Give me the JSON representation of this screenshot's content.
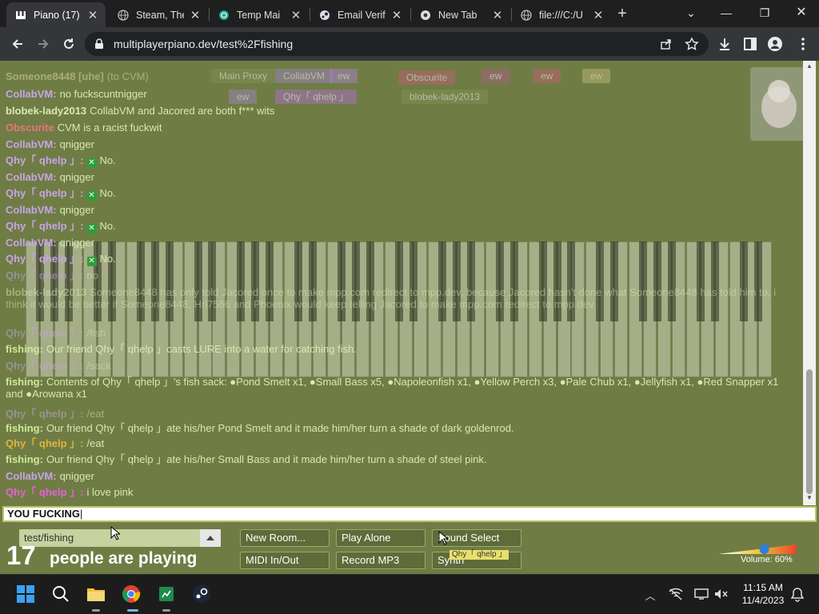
{
  "browser": {
    "tabs": [
      {
        "label": "Piano (17)",
        "icon": "piano-icon",
        "active": true
      },
      {
        "label": "Steam, The",
        "icon": "globe-icon",
        "active": false
      },
      {
        "label": "Temp Mai",
        "icon": "temp-mail-icon",
        "active": false
      },
      {
        "label": "Email Verif",
        "icon": "steam-icon",
        "active": false
      },
      {
        "label": "New Tab",
        "icon": "chrome-icon",
        "active": false
      },
      {
        "label": "file:///C:/U",
        "icon": "globe-icon",
        "active": false
      }
    ],
    "url": "multiplayerpiano.dev/test%2Ffishing"
  },
  "piano_bar": {
    "names": [
      "Main Proxy",
      "CollabVM",
      "ew",
      "ew",
      "ew",
      "ew",
      "Qhy「 qhelp 」",
      "blobek-lady2013",
      "Obscurite"
    ]
  },
  "chat": {
    "lines": [
      {
        "who": "Someone8448 [uhe]",
        "text": "(to CVM)",
        "color": "#e3d9a9",
        "fade": true
      },
      {
        "who": "CollabVM:",
        "text": "no fuckscuntnigger",
        "color": "#c7a4e8",
        "fade": false
      },
      {
        "who": "blobek-lady2013",
        "text": "CollabVM and Jacored are both f*** wits",
        "color": "#d9e8b2",
        "fade": false
      },
      {
        "who": "Obscurite",
        "text": "CVM is a racist fuckwit",
        "color": "#e6757a",
        "fade": false
      },
      {
        "who": "CollabVM:",
        "text": "qnigger",
        "color": "#c7a4e8",
        "fade": false
      },
      {
        "who": "Qhy「 qhelp 」:",
        "text": "No.",
        "color": "#c7a4e8",
        "fade": false
      },
      {
        "who": "CollabVM:",
        "text": "qnigger",
        "color": "#c7a4e8",
        "fade": false
      },
      {
        "who": "Qhy「 qhelp 」:",
        "text": "No.",
        "color": "#c7a4e8",
        "fade": false
      },
      {
        "who": "CollabVM:",
        "text": "qnigger",
        "color": "#c7a4e8",
        "fade": false
      },
      {
        "who": "Qhy「 qhelp 」:",
        "text": "No.",
        "color": "#c7a4e8",
        "fade": false
      },
      {
        "who": "CollabVM:",
        "text": "qnigger",
        "color": "#c7a4e8",
        "fade": false
      },
      {
        "who": "Qhy「 qhelp 」:",
        "text": "No.",
        "color": "#c7a4e8",
        "fade": false
      },
      {
        "who": "Qhy「 qhelp 」:",
        "text": "no",
        "color": "#c7a4e8",
        "fade": true
      },
      {
        "who": "blobek-lady2013",
        "text": "Someone8448 has only told Jacored once to make mpp.com redirect to mpp.dev, because Jacored hasn't done what Someone8448 has told him to, i think it would be better if Someone8448, Hri7566 and Phoenix would keep telling Jacored to make mpp.com redirect to mpp.dev",
        "color": "#d9e8b2",
        "fade": true
      },
      {
        "who": "Qhy「 qhelp 」:",
        "text": "/fish",
        "color": "#c7a4e8",
        "fade": true
      },
      {
        "who": "fishing:",
        "text": "Our friend Qhy「 qhelp 」casts LURE into a water for catching fish.",
        "color": "#cfe89a",
        "fade": false
      },
      {
        "who": "Qhy「 qhelp 」:",
        "text": "/sack",
        "color": "#c7a4e8",
        "fade": true
      },
      {
        "who": "fishing:",
        "text": "Contents of Qhy「 qhelp 」's fish sack: ●Pond Smelt x1, ●Small Bass x5, ●Napoleonfish x1, ●Yellow Perch x3, ●Pale Chub x1, ●Jellyfish x1, ●Red Snapper x1 and ●Arowana x1",
        "color": "#cfe89a",
        "fade": false
      },
      {
        "who": "Qhy「 qhelp 」:",
        "text": "/eat",
        "color": "#c7a4e8",
        "fade": true
      },
      {
        "who": "fishing:",
        "text": "Our friend Qhy「 qhelp 」ate his/her Pond Smelt and it made him/her turn a shade of dark goldenrod.",
        "color": "#cfe89a",
        "fade": false
      },
      {
        "who": "Qhy「 qhelp 」:",
        "text": "/eat",
        "color": "#e3b23c",
        "fade": false
      },
      {
        "who": "fishing:",
        "text": "Our friend Qhy「 qhelp 」ate his/her Small Bass and it made him/her turn a shade of steel pink.",
        "color": "#cfe89a",
        "fade": false
      },
      {
        "who": "CollabVM:",
        "text": "qnigger",
        "color": "#c7a4e8",
        "fade": false
      },
      {
        "who": "Qhy「 qhelp 」:",
        "text": "i love pink",
        "color": "#e860d8",
        "fade": false
      }
    ]
  },
  "input": {
    "value": "YOU FUCKING"
  },
  "controls": {
    "room": "test/fishing",
    "count": "17",
    "count_text": "people are playing",
    "new_room": "New Room...",
    "play_alone": "Play Alone",
    "sound_select": "Sound Select",
    "midi": "MIDI In/Out",
    "record": "Record MP3",
    "synth": "Synth",
    "volume_label": "Volume: 60%",
    "volume_value": 0.6,
    "tooltip": "Qhy「 qhelp 」"
  },
  "taskbar": {
    "time": "11:15 AM",
    "date": "11/4/2023"
  }
}
